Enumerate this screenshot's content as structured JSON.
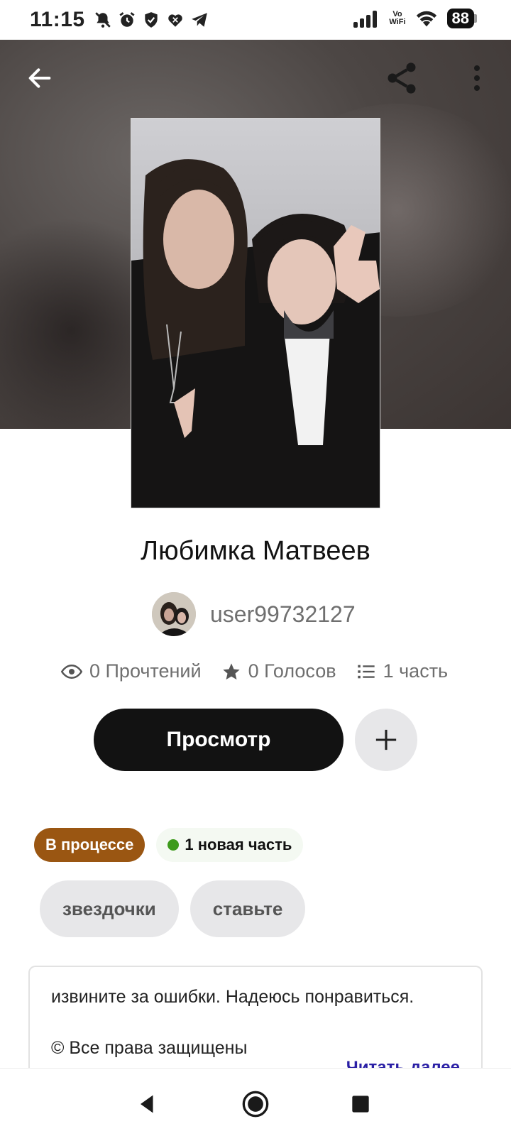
{
  "status_bar": {
    "time": "11:15",
    "battery": "88",
    "volte_top": "Vo",
    "volte_bottom": "WiFi",
    "left_icons": [
      "mute-icon",
      "alarm-icon",
      "shield-icon",
      "heart-icon",
      "telegram-icon"
    ],
    "right_icons": [
      "signal-icon",
      "wifi-icon",
      "battery-icon"
    ]
  },
  "header": {
    "back_icon": "arrow-left-icon",
    "share_icon": "share-icon",
    "more_icon": "more-vertical-icon"
  },
  "story": {
    "title": "Любимка Матвеев",
    "author": "user99732127",
    "stats": {
      "reads": "0 Прочтений",
      "votes": "0 Голосов",
      "parts": "1 часть"
    },
    "read_button": "Просмотр",
    "add_icon": "plus-icon",
    "status_badge": "В процессе",
    "new_part_badge": "1 новая часть",
    "tags": [
      "звездочки",
      "ставьте"
    ],
    "description_lines": [
      "извините за ошибки. Надеюсь понравиться.",
      "© Все права защищены"
    ],
    "read_more": "Читать далее"
  },
  "colors": {
    "primary_button": "#121212",
    "status_badge": "#9a5612",
    "new_dot": "#3d9a1b",
    "read_more_link": "#2a1fa5"
  },
  "nav_bar": {
    "icons": [
      "back-triangle-icon",
      "home-circle-icon",
      "recents-square-icon"
    ]
  }
}
